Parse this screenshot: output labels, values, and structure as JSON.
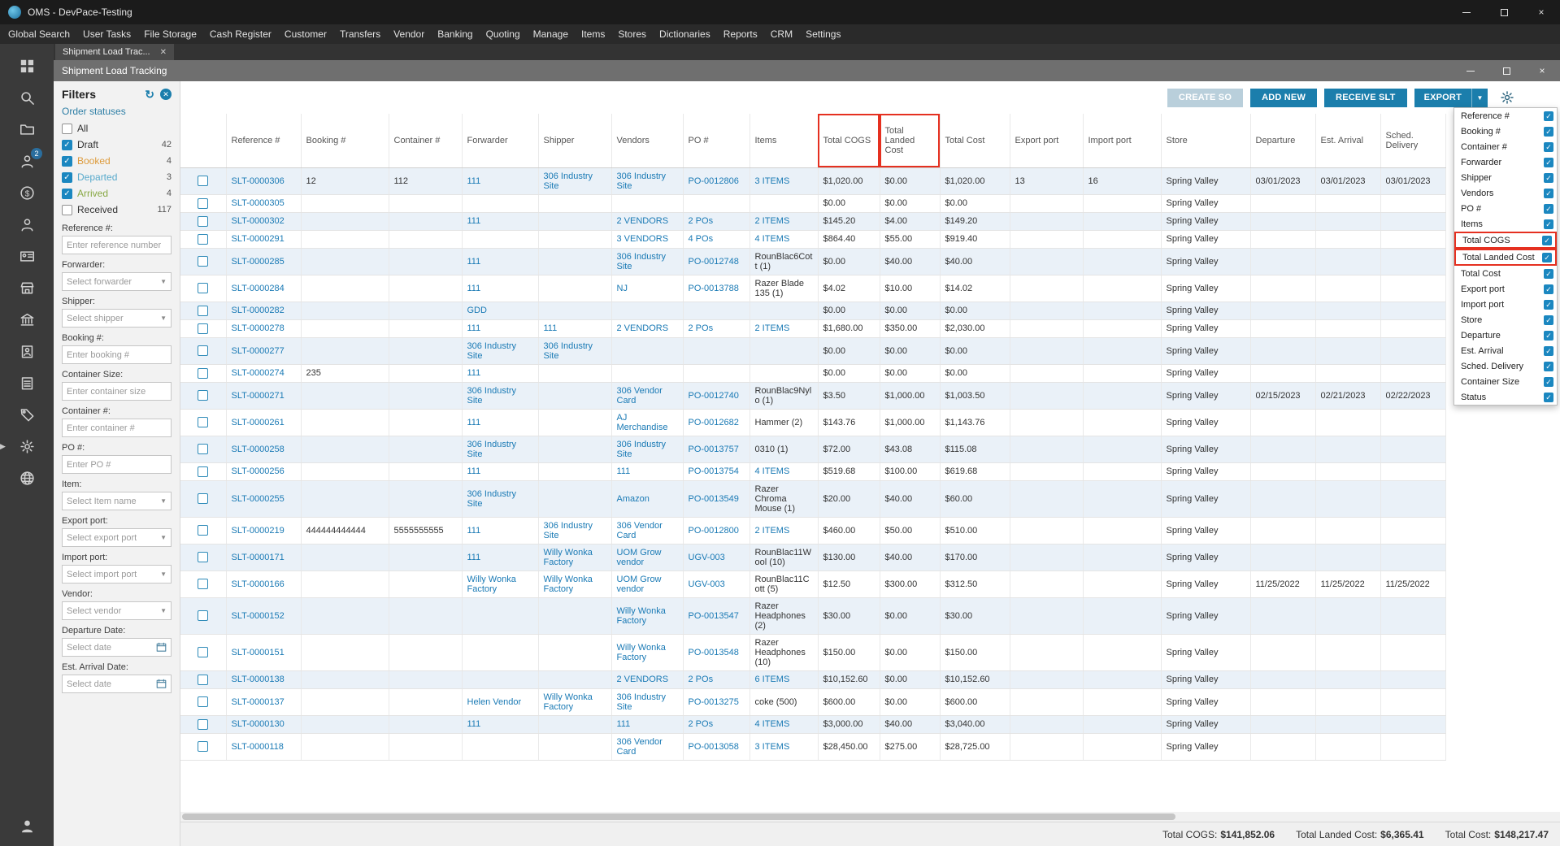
{
  "window": {
    "title": "OMS - DevPace-Testing"
  },
  "menu": {
    "items": [
      "Global Search",
      "User Tasks",
      "File Storage",
      "Cash Register",
      "Customer",
      "Transfers",
      "Vendor",
      "Banking",
      "Quoting",
      "Manage",
      "Items",
      "Stores",
      "Dictionaries",
      "Reports",
      "CRM",
      "Settings"
    ]
  },
  "tab": {
    "label": "Shipment Load Trac..."
  },
  "inner_window": {
    "title": "Shipment Load Tracking"
  },
  "sidebar": {
    "items": [
      {
        "name": "dashboard-icon"
      },
      {
        "name": "global-search-icon"
      },
      {
        "name": "file-storage-icon"
      },
      {
        "name": "user-tasks-icon",
        "badge": "2"
      },
      {
        "name": "cash-register-icon"
      },
      {
        "name": "customer-icon"
      },
      {
        "name": "vendor-card-icon"
      },
      {
        "name": "stores-icon"
      },
      {
        "name": "banking-icon"
      },
      {
        "name": "manage-icon"
      },
      {
        "name": "items-icon"
      },
      {
        "name": "tags-icon"
      },
      {
        "name": "settings-icon"
      },
      {
        "name": "dictionaries-icon"
      }
    ],
    "bottom_item": {
      "name": "profile-icon"
    }
  },
  "filters": {
    "title": "Filters",
    "statuses_label": "Order statuses",
    "statuses": [
      {
        "label": "All",
        "count": "",
        "checked": false,
        "color": ""
      },
      {
        "label": "Draft",
        "count": "42",
        "checked": true,
        "color": ""
      },
      {
        "label": "Booked",
        "count": "4",
        "checked": true,
        "color": "#dd9b3c"
      },
      {
        "label": "Departed",
        "count": "3",
        "checked": true,
        "color": "#58aacc"
      },
      {
        "label": "Arrived",
        "count": "4",
        "checked": true,
        "color": "#88a844"
      },
      {
        "label": "Received",
        "count": "117",
        "checked": false,
        "color": ""
      }
    ],
    "fields": [
      {
        "label": "Reference #:",
        "type": "text",
        "placeholder": "Enter reference number"
      },
      {
        "label": "Forwarder:",
        "type": "select",
        "placeholder": "Select forwarder"
      },
      {
        "label": "Shipper:",
        "type": "select",
        "placeholder": "Select shipper"
      },
      {
        "label": "Booking #:",
        "type": "text",
        "placeholder": "Enter booking #"
      },
      {
        "label": "Container Size:",
        "type": "text",
        "placeholder": "Enter container size"
      },
      {
        "label": "Container #:",
        "type": "text",
        "placeholder": "Enter container #"
      },
      {
        "label": "PO #:",
        "type": "text",
        "placeholder": "Enter PO #"
      },
      {
        "label": "Item:",
        "type": "select",
        "placeholder": "Select Item name"
      },
      {
        "label": "Export port:",
        "type": "select",
        "placeholder": "Select export port"
      },
      {
        "label": "Import port:",
        "type": "select",
        "placeholder": "Select import port"
      },
      {
        "label": "Vendor:",
        "type": "select",
        "placeholder": "Select vendor"
      },
      {
        "label": "Departure Date:",
        "type": "date",
        "placeholder": "Select date"
      },
      {
        "label": "Est. Arrival Date:",
        "type": "date",
        "placeholder": "Select date"
      }
    ]
  },
  "toolbar": {
    "buttons": [
      {
        "label": "CREATE SO",
        "disabled": true
      },
      {
        "label": "ADD NEW",
        "disabled": false
      },
      {
        "label": "RECEIVE SLT",
        "disabled": false
      },
      {
        "label": "EXPORT",
        "disabled": false,
        "split": true
      }
    ]
  },
  "table": {
    "columns": [
      {
        "key": "reference",
        "label": "Reference #"
      },
      {
        "key": "booking",
        "label": "Booking #"
      },
      {
        "key": "container",
        "label": "Container #"
      },
      {
        "key": "forwarder",
        "label": "Forwarder"
      },
      {
        "key": "shipper",
        "label": "Shipper"
      },
      {
        "key": "vendors",
        "label": "Vendors"
      },
      {
        "key": "po",
        "label": "PO #"
      },
      {
        "key": "items",
        "label": "Items"
      },
      {
        "key": "cogs",
        "label": "Total COGS",
        "highlight": true
      },
      {
        "key": "landed",
        "label": "Total Landed Cost",
        "highlight": true
      },
      {
        "key": "cost",
        "label": "Total Cost"
      },
      {
        "key": "export_port",
        "label": "Export port"
      },
      {
        "key": "import_port",
        "label": "Import port"
      },
      {
        "key": "store",
        "label": "Store"
      },
      {
        "key": "departure",
        "label": "Departure"
      },
      {
        "key": "est_arrival",
        "label": "Est. Arrival"
      },
      {
        "key": "sched_delivery",
        "label": "Sched. Delivery"
      }
    ],
    "rows": [
      {
        "reference": "SLT-0000306",
        "booking": "12",
        "container": "112",
        "forwarder": "111",
        "shipper": "306 Industry Site",
        "vendors": "306 Industry Site",
        "po": "PO-0012806",
        "items": "3 ITEMS",
        "cogs": "$1,020.00",
        "landed": "$0.00",
        "cost": "$1,020.00",
        "export_port": "13",
        "import_port": "16",
        "store": "Spring Valley",
        "departure": "03/01/2023",
        "est_arrival": "03/01/2023",
        "sched_delivery": "03/01/2023"
      },
      {
        "reference": "SLT-0000305",
        "cogs": "$0.00",
        "landed": "$0.00",
        "cost": "$0.00",
        "store": "Spring Valley"
      },
      {
        "reference": "SLT-0000302",
        "forwarder": "111",
        "vendors": "2 VENDORS",
        "po": "2 POs",
        "items": "2 ITEMS",
        "cogs": "$145.20",
        "landed": "$4.00",
        "cost": "$149.20",
        "store": "Spring Valley"
      },
      {
        "reference": "SLT-0000291",
        "vendors": "3 VENDORS",
        "po": "4 POs",
        "items": "4 ITEMS",
        "cogs": "$864.40",
        "landed": "$55.00",
        "cost": "$919.40",
        "store": "Spring Valley"
      },
      {
        "reference": "SLT-0000285",
        "forwarder": "111",
        "vendors": "306 Industry Site",
        "po": "PO-0012748",
        "items": "RounBlac6Cott (1)",
        "cogs": "$0.00",
        "landed": "$40.00",
        "cost": "$40.00",
        "store": "Spring Valley"
      },
      {
        "reference": "SLT-0000284",
        "forwarder": "111",
        "vendors": "NJ",
        "po": "PO-0013788",
        "items": "Razer Blade 135 (1)",
        "cogs": "$4.02",
        "landed": "$10.00",
        "cost": "$14.02",
        "store": "Spring Valley"
      },
      {
        "reference": "SLT-0000282",
        "forwarder": "GDD",
        "cogs": "$0.00",
        "landed": "$0.00",
        "cost": "$0.00",
        "store": "Spring Valley"
      },
      {
        "reference": "SLT-0000278",
        "forwarder": "111",
        "shipper": "111",
        "vendors": "2 VENDORS",
        "po": "2 POs",
        "items": "2 ITEMS",
        "cogs": "$1,680.00",
        "landed": "$350.00",
        "cost": "$2,030.00",
        "store": "Spring Valley"
      },
      {
        "reference": "SLT-0000277",
        "forwarder": "306 Industry Site",
        "shipper": "306 Industry Site",
        "cogs": "$0.00",
        "landed": "$0.00",
        "cost": "$0.00",
        "store": "Spring Valley"
      },
      {
        "reference": "SLT-0000274",
        "booking": "235",
        "forwarder": "111",
        "cogs": "$0.00",
        "landed": "$0.00",
        "cost": "$0.00",
        "store": "Spring Valley"
      },
      {
        "reference": "SLT-0000271",
        "forwarder": "306 Industry Site",
        "vendors": "306 Vendor Card",
        "po": "PO-0012740",
        "items": "RounBlac9Nylo (1)",
        "cogs": "$3.50",
        "landed": "$1,000.00",
        "cost": "$1,003.50",
        "store": "Spring Valley",
        "departure": "02/15/2023",
        "est_arrival": "02/21/2023",
        "sched_delivery": "02/22/2023"
      },
      {
        "reference": "SLT-0000261",
        "forwarder": "111",
        "vendors": "AJ Merchandise",
        "po": "PO-0012682",
        "items": "Hammer (2)",
        "cogs": "$143.76",
        "landed": "$1,000.00",
        "cost": "$1,143.76",
        "store": "Spring Valley"
      },
      {
        "reference": "SLT-0000258",
        "forwarder": "306 Industry Site",
        "vendors": "306 Industry Site",
        "po": "PO-0013757",
        "items": "0310 (1)",
        "cogs": "$72.00",
        "landed": "$43.08",
        "cost": "$115.08",
        "store": "Spring Valley"
      },
      {
        "reference": "SLT-0000256",
        "forwarder": "111",
        "vendors": "111",
        "po": "PO-0013754",
        "items": "4 ITEMS",
        "cogs": "$519.68",
        "landed": "$100.00",
        "cost": "$619.68",
        "store": "Spring Valley"
      },
      {
        "reference": "SLT-0000255",
        "forwarder": "306 Industry Site",
        "vendors": "Amazon",
        "po": "PO-0013549",
        "items": "Razer Chroma Mouse (1)",
        "cogs": "$20.00",
        "landed": "$40.00",
        "cost": "$60.00",
        "store": "Spring Valley"
      },
      {
        "reference": "SLT-0000219",
        "booking": "444444444444",
        "container": "5555555555",
        "forwarder": "111",
        "shipper": "306 Industry Site",
        "vendors": "306 Vendor Card",
        "po": "PO-0012800",
        "items": "2 ITEMS",
        "cogs": "$460.00",
        "landed": "$50.00",
        "cost": "$510.00",
        "store": "Spring Valley"
      },
      {
        "reference": "SLT-0000171",
        "forwarder": "111",
        "shipper": "Willy Wonka Factory",
        "vendors": "UOM Grow vendor",
        "po": "UGV-003",
        "items": "RounBlac11Wool (10)",
        "cogs": "$130.00",
        "landed": "$40.00",
        "cost": "$170.00",
        "store": "Spring Valley"
      },
      {
        "reference": "SLT-0000166",
        "forwarder": "Willy Wonka Factory",
        "shipper": "Willy Wonka Factory",
        "vendors": "UOM Grow vendor",
        "po": "UGV-003",
        "items": "RounBlac11Cott (5)",
        "cogs": "$12.50",
        "landed": "$300.00",
        "cost": "$312.50",
        "store": "Spring Valley",
        "departure": "11/25/2022",
        "est_arrival": "11/25/2022",
        "sched_delivery": "11/25/2022"
      },
      {
        "reference": "SLT-0000152",
        "vendors": "Willy Wonka Factory",
        "po": "PO-0013547",
        "items": "Razer Headphones (2)",
        "cogs": "$30.00",
        "landed": "$0.00",
        "cost": "$30.00",
        "store": "Spring Valley"
      },
      {
        "reference": "SLT-0000151",
        "vendors": "Willy Wonka Factory",
        "po": "PO-0013548",
        "items": "Razer Headphones (10)",
        "cogs": "$150.00",
        "landed": "$0.00",
        "cost": "$150.00",
        "store": "Spring Valley"
      },
      {
        "reference": "SLT-0000138",
        "vendors": "2 VENDORS",
        "po": "2 POs",
        "items": "6 ITEMS",
        "cogs": "$10,152.60",
        "landed": "$0.00",
        "cost": "$10,152.60",
        "store": "Spring Valley"
      },
      {
        "reference": "SLT-0000137",
        "forwarder": "Helen Vendor",
        "shipper": "Willy Wonka Factory",
        "vendors": "306 Industry Site",
        "po": "PO-0013275",
        "items": "coke (500)",
        "cogs": "$600.00",
        "landed": "$0.00",
        "cost": "$600.00",
        "store": "Spring Valley"
      },
      {
        "reference": "SLT-0000130",
        "forwarder": "111",
        "vendors": "111",
        "po": "2 POs",
        "items": "4 ITEMS",
        "cogs": "$3,000.00",
        "landed": "$40.00",
        "cost": "$3,040.00",
        "store": "Spring Valley"
      },
      {
        "reference": "SLT-0000118",
        "vendors": "306 Vendor Card",
        "po": "PO-0013058",
        "items": "3 ITEMS",
        "cogs": "$28,450.00",
        "landed": "$275.00",
        "cost": "$28,725.00",
        "store": "Spring Valley"
      }
    ]
  },
  "column_chooser": {
    "items": [
      {
        "label": "Reference #",
        "checked": true
      },
      {
        "label": "Booking #",
        "checked": true
      },
      {
        "label": "Container #",
        "checked": true
      },
      {
        "label": "Forwarder",
        "checked": true
      },
      {
        "label": "Shipper",
        "checked": true
      },
      {
        "label": "Vendors",
        "checked": true
      },
      {
        "label": "PO #",
        "checked": true
      },
      {
        "label": "Items",
        "checked": true
      },
      {
        "label": "Total COGS",
        "checked": true,
        "highlight": true
      },
      {
        "label": "Total Landed Cost",
        "checked": true,
        "highlight": true
      },
      {
        "label": "Total Cost",
        "checked": true
      },
      {
        "label": "Export port",
        "checked": true
      },
      {
        "label": "Import port",
        "checked": true
      },
      {
        "label": "Store",
        "checked": true
      },
      {
        "label": "Departure",
        "checked": true
      },
      {
        "label": "Est. Arrival",
        "checked": true
      },
      {
        "label": "Sched. Delivery",
        "checked": true
      },
      {
        "label": "Container Size",
        "checked": true
      },
      {
        "label": "Status",
        "checked": true
      }
    ]
  },
  "footer": {
    "totals": [
      {
        "label": "Total COGS:",
        "value": "$141,852.06"
      },
      {
        "label": "Total Landed Cost:",
        "value": "$6,365.41"
      },
      {
        "label": "Total Cost:",
        "value": "$148,217.47"
      }
    ]
  },
  "colors": {
    "accent": "#1b7eac",
    "link": "#1a7ab5",
    "highlight_red": "#e53020",
    "status_booked": "#dd9b3c",
    "status_departed": "#58aacc",
    "status_arrived": "#88a844"
  }
}
